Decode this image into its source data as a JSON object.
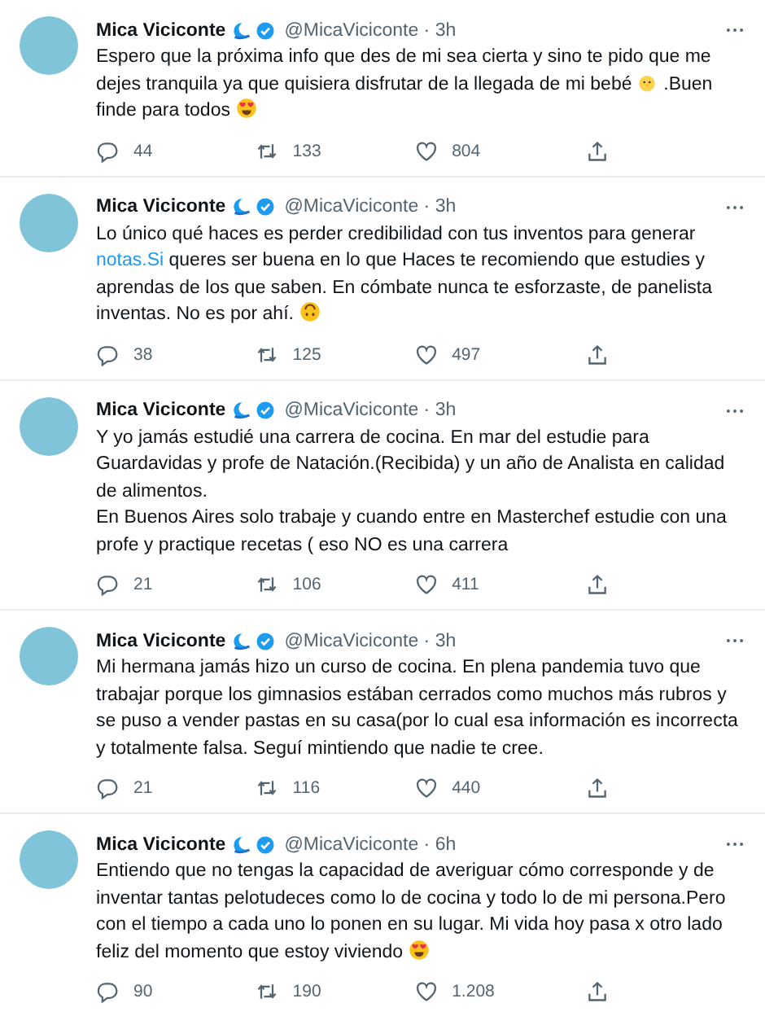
{
  "tweets": [
    {
      "name": "Mica Viciconte",
      "handle": "@MicaViciconte · 3h",
      "paragraphs": [
        [
          {
            "kind": "text",
            "text": "Espero que la próxima info que des de mi sea cierta y sino te pido que me dejes tranquila ya que quisiera disfrutar de la llegada de mi bebé "
          },
          {
            "kind": "chick"
          },
          {
            "kind": "text",
            "text": " .Buen finde para todos "
          },
          {
            "kind": "hearteyes"
          }
        ]
      ],
      "replies": "44",
      "retweets": "133",
      "likes": "804"
    },
    {
      "name": "Mica Viciconte",
      "handle": "@MicaViciconte · 3h",
      "paragraphs": [
        [
          {
            "kind": "text",
            "text": "Lo único qué haces es perder credibilidad con tus inventos para generar "
          },
          {
            "kind": "link",
            "text": "notas.Si"
          },
          {
            "kind": "text",
            "text": " queres ser buena en lo que Haces te recomiendo que estudies y aprendas de los que saben. En cómbate nunca te esforzaste, de panelista inventas. No es por ahí. "
          },
          {
            "kind": "upsidedown"
          }
        ]
      ],
      "replies": "38",
      "retweets": "125",
      "likes": "497"
    },
    {
      "name": "Mica Viciconte",
      "handle": "@MicaViciconte · 3h",
      "paragraphs": [
        [
          {
            "kind": "text",
            "text": "Y yo jamás estudié una carrera de cocina. En mar del estudie para Guardavidas y profe de Natación.(Recibida) y un año de Analista en calidad de alimentos."
          }
        ],
        [
          {
            "kind": "text",
            "text": "En Buenos Aires solo trabaje y cuando entre en Masterchef estudie con una profe  y practique recetas ( eso NO es una carrera"
          }
        ]
      ],
      "replies": "21",
      "retweets": "106",
      "likes": "411"
    },
    {
      "name": "Mica Viciconte",
      "handle": "@MicaViciconte · 3h",
      "paragraphs": [
        [
          {
            "kind": "text",
            "text": "Mi hermana jamás hizo un curso de cocina. En plena pandemia tuvo que trabajar porque los gimnasios estában cerrados como muchos más rubros y se puso a vender pastas en su casa(por lo cual esa información es incorrecta y totalmente falsa. Seguí mintiendo que nadie te cree."
          }
        ]
      ],
      "replies": "21",
      "retweets": "116",
      "likes": "440"
    },
    {
      "name": "Mica Viciconte",
      "handle": "@MicaViciconte · 6h",
      "paragraphs": [
        [
          {
            "kind": "text",
            "text": "Entiendo que no tengas la capacidad de averiguar cómo corresponde y de inventar tantas pelotudeces como lo de cocina y todo lo de mi persona.Pero con el tiempo a cada uno lo ponen en su lugar. Mi vida hoy pasa x otro lado feliz del momento que estoy viviendo "
          },
          {
            "kind": "hearteyes"
          }
        ]
      ],
      "replies": "90",
      "retweets": "190",
      "likes": "1.208"
    }
  ]
}
